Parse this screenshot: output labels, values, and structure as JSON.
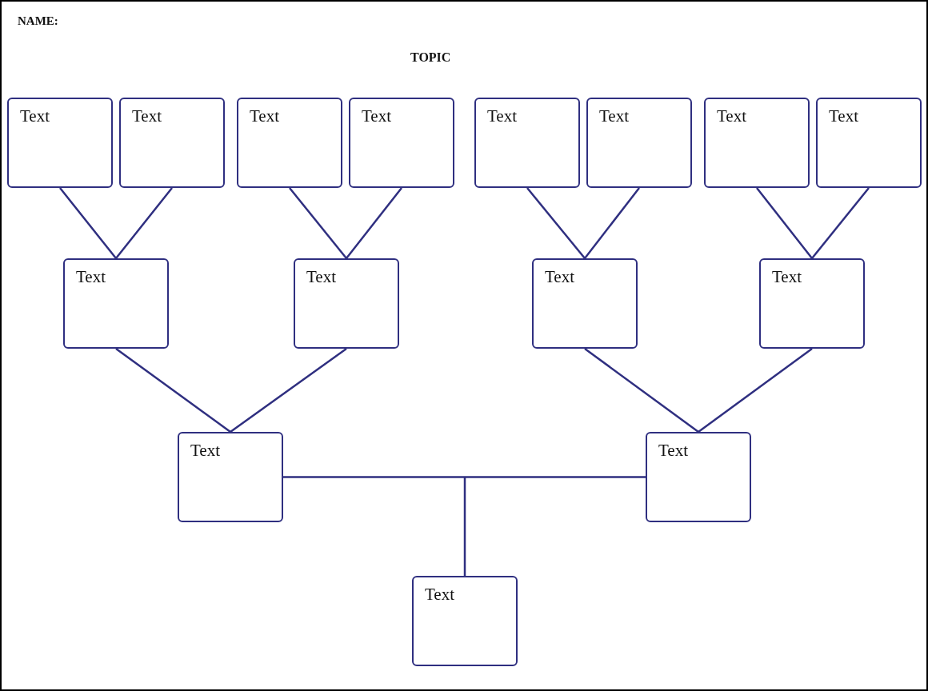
{
  "header": {
    "name_label": "NAME:",
    "topic": "TOPIC"
  },
  "tree": {
    "text": "Text",
    "children": [
      {
        "text": "Text",
        "children": [
          {
            "text": "Text",
            "children": [
              {
                "text": "Text"
              },
              {
                "text": "Text"
              }
            ]
          },
          {
            "text": "Text",
            "children": [
              {
                "text": "Text"
              },
              {
                "text": "Text"
              }
            ]
          }
        ]
      },
      {
        "text": "Text",
        "children": [
          {
            "text": "Text",
            "children": [
              {
                "text": "Text"
              },
              {
                "text": "Text"
              }
            ]
          },
          {
            "text": "Text",
            "children": [
              {
                "text": "Text"
              },
              {
                "text": "Text"
              }
            ]
          }
        ]
      }
    ]
  }
}
